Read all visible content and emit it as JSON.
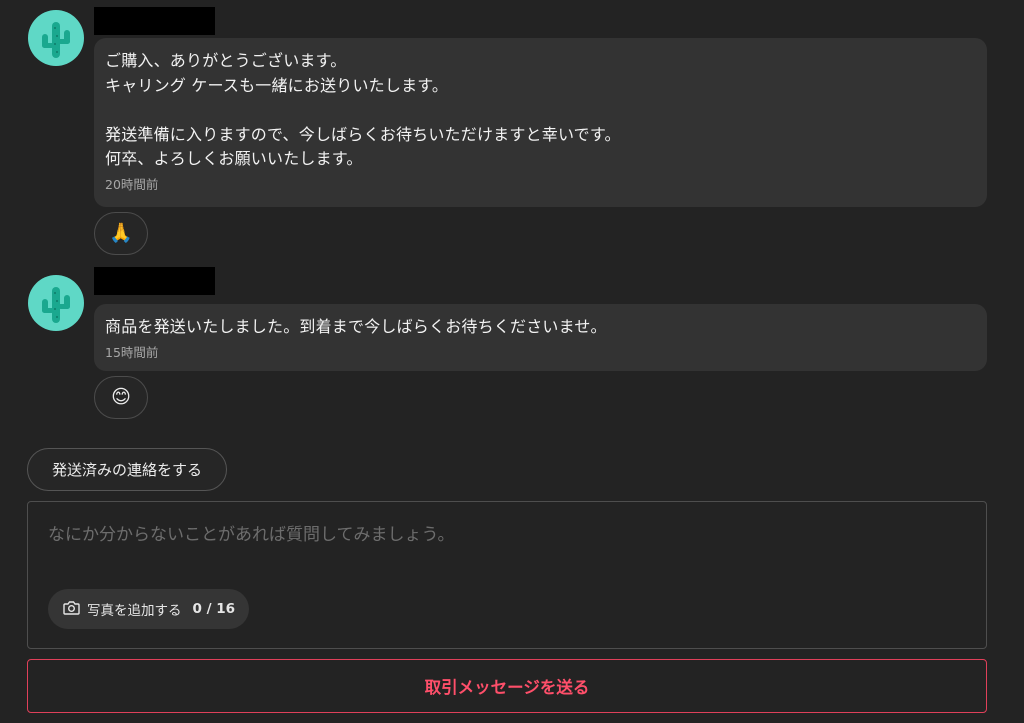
{
  "messages": [
    {
      "text": "ご購入、ありがとうございます。\nキャリング ケースも一緒にお送りいたします。\n\n発送準備に入りますので、今しばらくお待ちいただけますと幸いです。\n何卒、よろしくお願いいたします。",
      "time": "20時間前",
      "reaction": "🙏"
    },
    {
      "text": "商品を発送いたしました。到着まで今しばらくお待ちくださいませ。",
      "time": "15時間前",
      "reaction": "😊"
    }
  ],
  "actions": {
    "shipped_label": "発送済みの連絡をする",
    "send_label": "取引メッセージを送る"
  },
  "compose": {
    "value": "",
    "placeholder": "なにか分からないことがあれば質問してみましょう。",
    "add_photo_label": "写真を追加する",
    "photo_count": "0 / 16"
  },
  "icons": {
    "avatar": "cactus-avatar-icon",
    "camera": "camera-icon"
  },
  "colors": {
    "background": "#232323",
    "bubble": "#333333",
    "avatar_bg": "#5fd8c6",
    "accent": "#ff4f6a"
  }
}
